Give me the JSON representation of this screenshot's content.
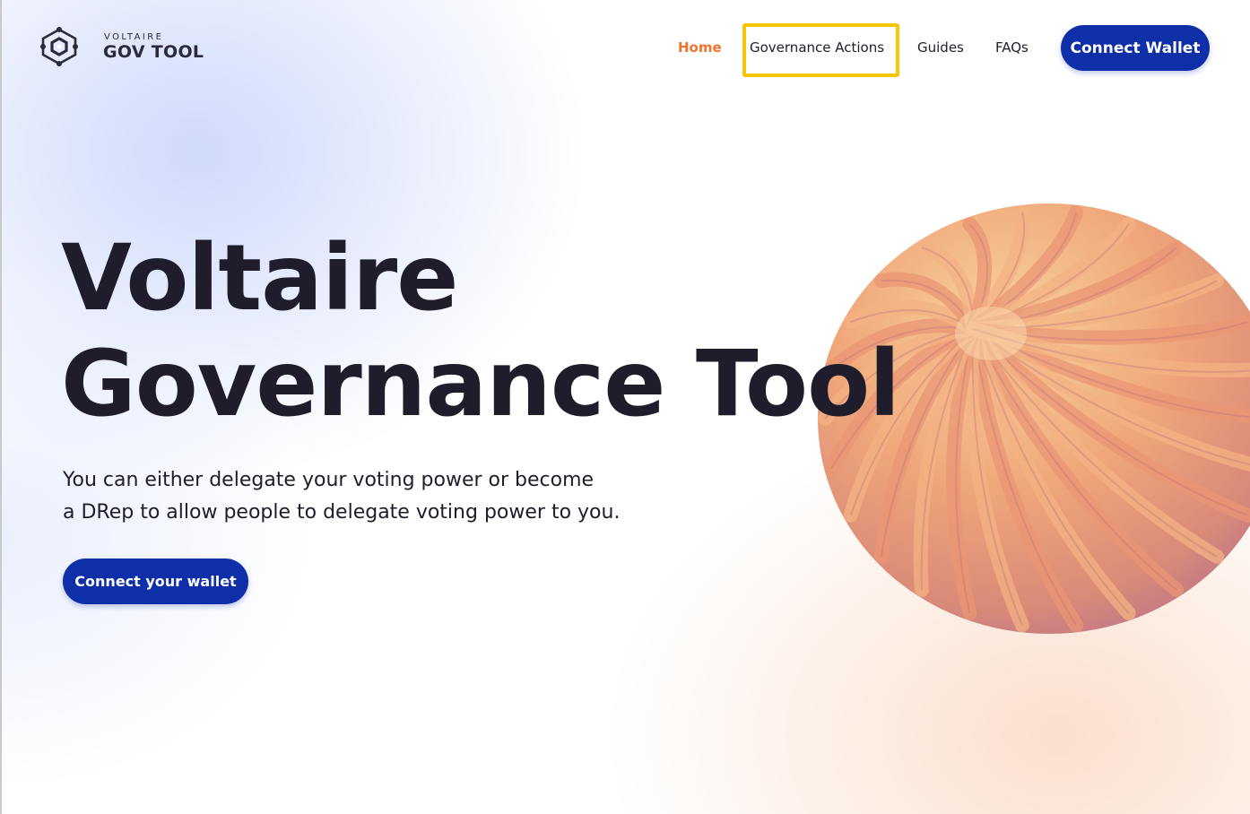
{
  "brand": {
    "small_label": "VOLTAIRE",
    "name": "GOV TOOL",
    "logo_icon": "hexagon-network-icon"
  },
  "nav": {
    "items": [
      {
        "label": "Home",
        "active": true
      },
      {
        "label": "Governance Actions",
        "active": false,
        "highlighted": true
      },
      {
        "label": "Guides",
        "active": false
      },
      {
        "label": "FAQs",
        "active": false
      }
    ],
    "connect_button": "Connect Wallet"
  },
  "hero": {
    "title_line1": "Voltaire",
    "title_line2": "Governance Tool",
    "subtitle_line1": "You can either delegate your voting power or become",
    "subtitle_line2": "a DRep to allow people to delegate voting power to you.",
    "cta_button": "Connect your wallet"
  },
  "colors": {
    "accent_orange": "#f0742d",
    "primary_blue": "#0f2fa8",
    "highlight_yellow": "#f9c509",
    "text_dark": "#1f1d2b"
  }
}
